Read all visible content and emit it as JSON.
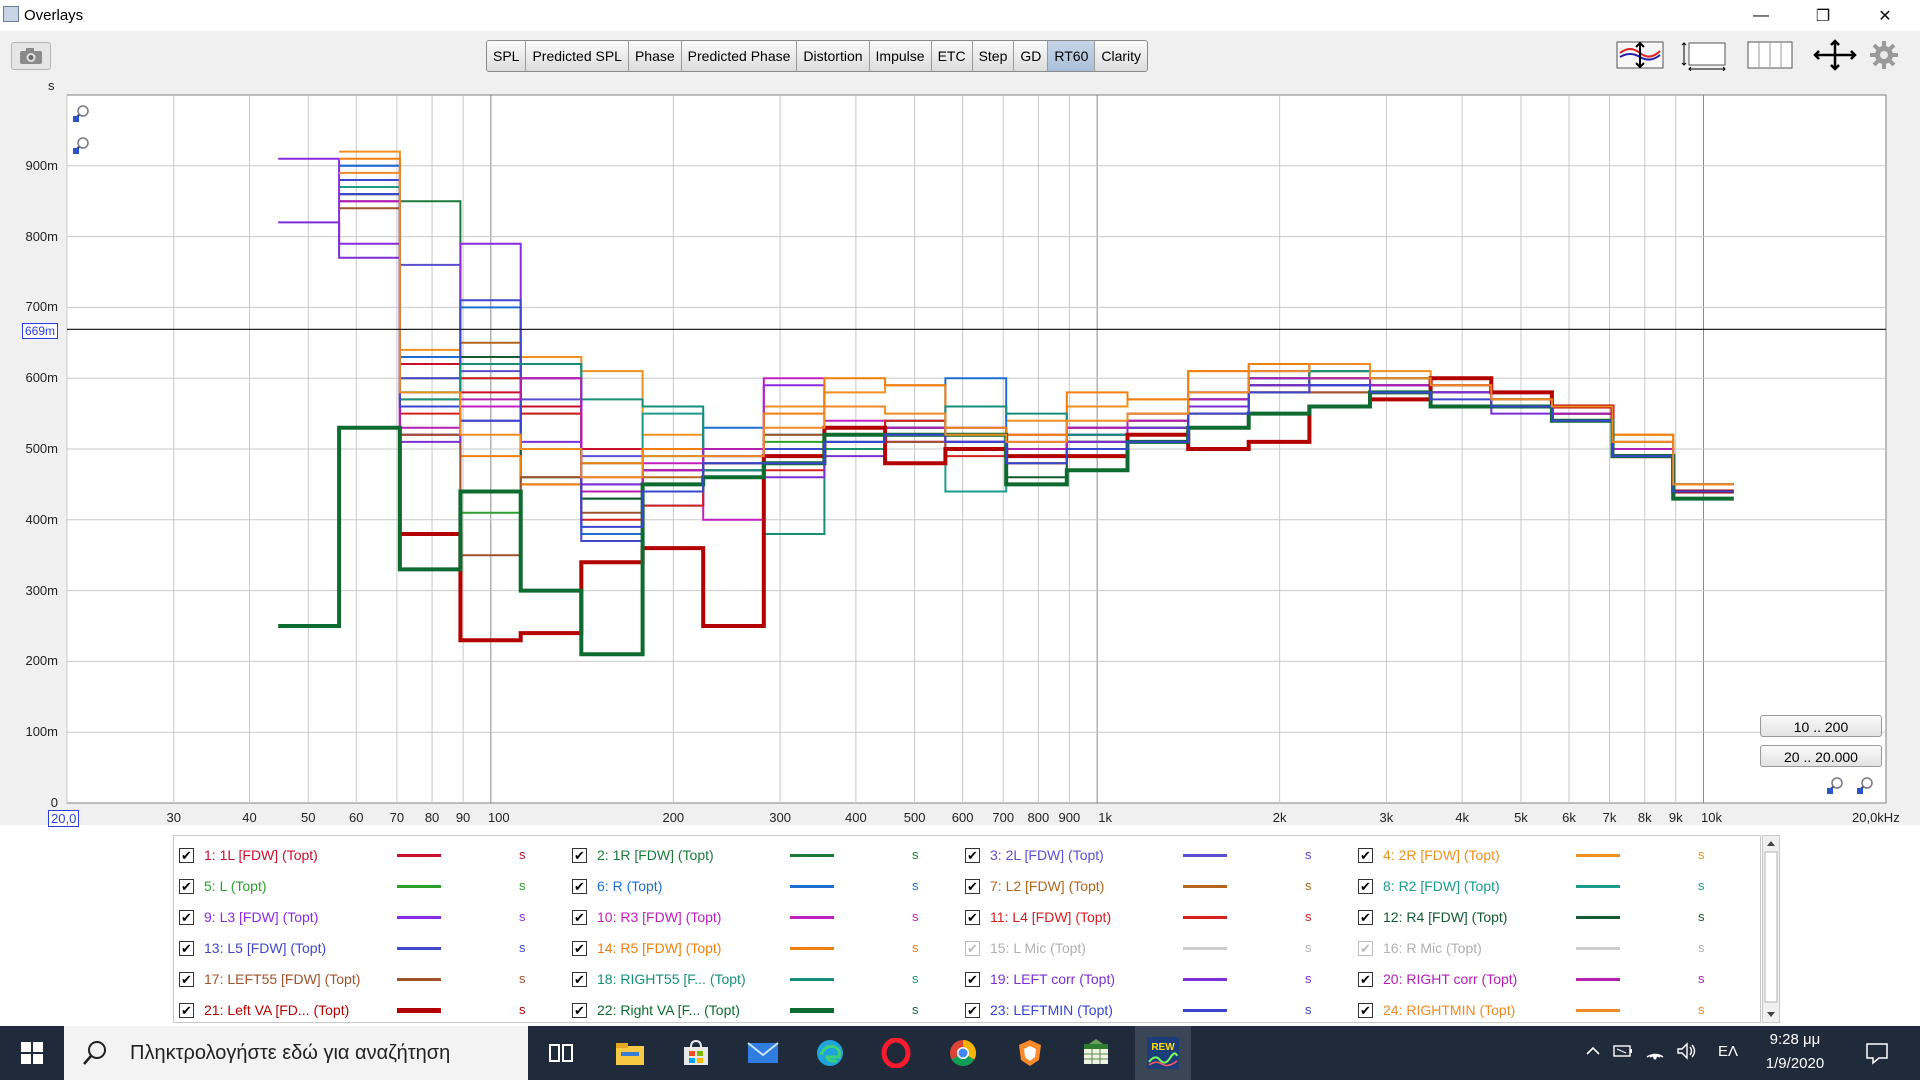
{
  "window": {
    "title": "Overlays",
    "controls": [
      "—",
      "❐",
      "✕"
    ]
  },
  "toolbar": {
    "tabs": [
      {
        "label": "SPL",
        "active": false
      },
      {
        "label": "Predicted SPL",
        "active": false
      },
      {
        "label": "Phase",
        "active": false
      },
      {
        "label": "Predicted Phase",
        "active": false
      },
      {
        "label": "Distortion",
        "active": false
      },
      {
        "label": "Impulse",
        "active": false
      },
      {
        "label": "ETC",
        "active": false
      },
      {
        "label": "Step",
        "active": false
      },
      {
        "label": "GD",
        "active": false
      },
      {
        "label": "RT60",
        "active": true
      },
      {
        "label": "Clarity",
        "active": false
      }
    ],
    "right_icons": [
      "y-scale-icon",
      "limits-icon",
      "panels-icon",
      "pan-icon",
      "gear-icon"
    ]
  },
  "graph": {
    "y_unit": "s",
    "y_ticks": [
      "0",
      "100m",
      "200m",
      "300m",
      "400m",
      "500m",
      "600m",
      "700m",
      "800m",
      "900m"
    ],
    "x_ticks": [
      "30",
      "40",
      "50",
      "60",
      "70",
      "80",
      "90",
      "100",
      "200",
      "300",
      "400",
      "500",
      "600",
      "700",
      "800",
      "900",
      "1k",
      "2k",
      "3k",
      "4k",
      "5k",
      "6k",
      "7k",
      "8k",
      "9k",
      "10k"
    ],
    "x_start": "20,0",
    "x_end": "20,0kHz",
    "cursor_y": "669m",
    "range_buttons": [
      "10 .. 200",
      "20 .. 20.000"
    ]
  },
  "chart_data": {
    "type": "line",
    "x_scale": "log",
    "xlim": [
      20,
      20000
    ],
    "ylim": [
      0,
      1.0
    ],
    "xlabel": "",
    "ylabel": "s",
    "x_unit": "Hz",
    "cursor_y": 0.669,
    "band_edges": [
      44.6,
      56.2,
      70.8,
      89.1,
      112,
      141,
      178,
      224,
      282,
      355,
      447,
      562,
      708,
      891,
      1122,
      1413,
      1778,
      2239,
      2818,
      3548,
      4467,
      5623,
      7079,
      8913,
      11220
    ],
    "series": [
      {
        "name": "1: 1L [FDW] (Topt)",
        "color": "#c8102e",
        "width": 2,
        "values": [
          null,
          null,
          0.62,
          0.58,
          0.56,
          0.5,
          0.47,
          0.48,
          0.49,
          0.5,
          0.51,
          0.52,
          0.52,
          0.53,
          0.55,
          0.57,
          0.58,
          0.6,
          0.59,
          0.58,
          0.57,
          0.55,
          0.5,
          0.44
        ]
      },
      {
        "name": "2: 1R [FDW] (Topt)",
        "color": "#1b7a3a",
        "width": 2,
        "values": [
          null,
          0.88,
          0.85,
          0.6,
          0.55,
          0.48,
          0.44,
          0.46,
          0.48,
          0.51,
          0.52,
          0.51,
          0.49,
          0.5,
          0.52,
          0.56,
          0.59,
          0.61,
          0.6,
          0.59,
          0.57,
          0.56,
          0.49,
          0.44
        ]
      },
      {
        "name": "3: 2L [FDW] (Topt)",
        "color": "#5a4fcf",
        "width": 2,
        "values": [
          null,
          0.9,
          0.76,
          0.61,
          0.57,
          0.49,
          0.45,
          0.48,
          0.5,
          0.52,
          0.53,
          0.52,
          0.5,
          0.52,
          0.54,
          0.58,
          0.6,
          0.6,
          0.59,
          0.58,
          0.56,
          0.55,
          0.49,
          0.45
        ]
      },
      {
        "name": "4: 2R [FDW] (Topt)",
        "color": "#f0901f",
        "width": 2,
        "values": [
          null,
          0.92,
          0.64,
          0.63,
          0.63,
          0.61,
          0.52,
          0.5,
          0.56,
          0.58,
          0.59,
          0.56,
          0.54,
          0.56,
          0.57,
          0.61,
          0.62,
          0.6,
          0.61,
          0.6,
          0.58,
          0.56,
          0.52,
          0.45
        ]
      },
      {
        "name": "5: L (Topt)",
        "color": "#2ca02c",
        "width": 2,
        "values": [
          null,
          0.87,
          0.58,
          0.41,
          0.5,
          0.43,
          0.49,
          0.5,
          0.51,
          0.52,
          0.53,
          0.52,
          0.5,
          0.51,
          0.53,
          0.56,
          0.59,
          0.61,
          0.6,
          0.6,
          0.57,
          0.55,
          0.49,
          0.44
        ]
      },
      {
        "name": "6: R (Topt)",
        "color": "#1f6fd1",
        "width": 2,
        "values": [
          null,
          0.9,
          0.63,
          0.7,
          0.5,
          0.38,
          0.42,
          0.53,
          0.49,
          0.51,
          0.52,
          0.6,
          0.5,
          0.51,
          0.52,
          0.57,
          0.6,
          0.6,
          0.58,
          0.58,
          0.56,
          0.55,
          0.5,
          0.45
        ]
      },
      {
        "name": "7: L2 [FDW] (Topt)",
        "color": "#b5651d",
        "width": 2,
        "values": [
          null,
          0.86,
          0.6,
          0.65,
          0.45,
          0.44,
          0.46,
          0.5,
          0.5,
          0.53,
          0.54,
          0.51,
          0.5,
          0.51,
          0.54,
          0.56,
          0.59,
          0.61,
          0.6,
          0.59,
          0.57,
          0.56,
          0.51,
          0.45
        ]
      },
      {
        "name": "8: R2 [FDW] (Topt)",
        "color": "#1a9b8c",
        "width": 2,
        "values": [
          null,
          0.87,
          0.58,
          0.62,
          0.62,
          0.43,
          0.55,
          0.49,
          0.52,
          0.53,
          0.54,
          0.44,
          0.45,
          0.51,
          0.52,
          0.57,
          0.59,
          0.6,
          0.59,
          0.59,
          0.56,
          0.55,
          0.5,
          0.45
        ]
      },
      {
        "name": "9: L3 [FDW] (Topt)",
        "color": "#8a2be2",
        "width": 2,
        "values": [
          0.91,
          0.79,
          0.52,
          0.79,
          0.6,
          0.45,
          0.5,
          0.47,
          0.59,
          0.5,
          0.52,
          0.53,
          0.51,
          0.53,
          0.55,
          0.58,
          0.61,
          0.59,
          0.58,
          0.58,
          0.56,
          0.54,
          0.5,
          0.44
        ]
      },
      {
        "name": "10: R3 [FDW] (Topt)",
        "color": "#c020c0",
        "width": 2,
        "values": [
          null,
          0.85,
          0.52,
          0.56,
          0.6,
          0.46,
          0.48,
          0.4,
          0.6,
          0.54,
          0.51,
          0.5,
          0.5,
          0.52,
          0.53,
          0.57,
          0.59,
          0.59,
          0.59,
          0.58,
          0.56,
          0.55,
          0.5,
          0.44
        ]
      },
      {
        "name": "11: L4 [FDW] (Topt)",
        "color": "#d62020",
        "width": 2,
        "values": [
          null,
          0.86,
          0.55,
          0.6,
          0.55,
          0.4,
          0.42,
          0.49,
          0.47,
          0.52,
          0.54,
          0.49,
          0.48,
          0.5,
          0.51,
          0.55,
          0.58,
          0.58,
          0.57,
          0.59,
          0.57,
          0.56,
          0.5,
          0.44
        ]
      },
      {
        "name": "12: R4 [FDW] (Topt)",
        "color": "#145a32",
        "width": 2,
        "values": [
          null,
          0.88,
          0.56,
          0.63,
          0.46,
          0.43,
          0.44,
          0.47,
          0.5,
          0.52,
          0.53,
          0.52,
          0.46,
          0.51,
          0.53,
          0.56,
          0.59,
          0.62,
          0.6,
          0.6,
          0.58,
          0.56,
          0.49,
          0.44
        ]
      },
      {
        "name": "13: L5 [FDW] (Topt)",
        "color": "#3f48cc",
        "width": 2,
        "values": [
          null,
          0.88,
          0.6,
          0.71,
          0.5,
          0.37,
          0.45,
          0.46,
          0.5,
          0.52,
          0.53,
          0.51,
          0.49,
          0.52,
          0.53,
          0.57,
          0.6,
          0.59,
          0.59,
          0.58,
          0.56,
          0.55,
          0.5,
          0.45
        ]
      },
      {
        "name": "14: R5 [FDW] (Topt)",
        "color": "#f07f0f",
        "width": 2,
        "values": [
          null,
          0.91,
          0.57,
          0.49,
          0.45,
          0.48,
          0.5,
          0.5,
          0.55,
          0.6,
          0.59,
          0.53,
          0.52,
          0.58,
          0.57,
          0.61,
          0.62,
          0.6,
          0.6,
          0.59,
          0.57,
          0.56,
          0.52,
          0.45
        ]
      },
      {
        "name": "15: L Mic (Topt)",
        "color": "#bbbbbb",
        "width": 2,
        "disabled": true,
        "values": []
      },
      {
        "name": "16: R Mic (Topt)",
        "color": "#bbbbbb",
        "width": 2,
        "disabled": true,
        "values": []
      },
      {
        "name": "17: LEFT55 [FDW] (Topt)",
        "color": "#a0522d",
        "width": 2,
        "values": [
          null,
          0.84,
          0.52,
          0.35,
          0.46,
          0.41,
          0.47,
          0.48,
          0.52,
          0.52,
          0.51,
          0.5,
          0.48,
          0.51,
          0.52,
          0.55,
          0.58,
          0.58,
          0.57,
          0.58,
          0.56,
          0.55,
          0.51,
          0.44
        ]
      },
      {
        "name": "18: RIGHT55 [F... (Topt)",
        "color": "#168f7a",
        "width": 2,
        "values": [
          null,
          0.86,
          0.57,
          0.62,
          0.62,
          0.57,
          0.56,
          0.47,
          0.38,
          0.5,
          0.52,
          0.56,
          0.55,
          0.52,
          0.53,
          0.57,
          0.6,
          0.61,
          0.6,
          0.6,
          0.57,
          0.56,
          0.5,
          0.44
        ]
      },
      {
        "name": "19: LEFT corr (Topt)",
        "color": "#7b2fd6",
        "width": 2,
        "values": [
          0.82,
          0.77,
          0.51,
          0.54,
          0.51,
          0.45,
          0.47,
          0.49,
          0.46,
          0.49,
          0.52,
          0.51,
          0.5,
          0.51,
          0.53,
          0.56,
          0.59,
          0.59,
          0.58,
          0.58,
          0.55,
          0.54,
          0.49,
          0.44
        ]
      },
      {
        "name": "20: RIGHT corr (Topt)",
        "color": "#b31fb3",
        "width": 2,
        "values": [
          null,
          0.85,
          0.53,
          0.57,
          0.6,
          0.44,
          0.47,
          0.5,
          0.49,
          0.52,
          0.53,
          0.51,
          0.5,
          0.53,
          0.54,
          0.57,
          0.6,
          0.6,
          0.59,
          0.59,
          0.56,
          0.55,
          0.5,
          0.44
        ]
      },
      {
        "name": "21: Left VA [FD... (Topt)",
        "color": "#b30000",
        "width": 4,
        "values": [
          null,
          null,
          0.38,
          0.23,
          0.24,
          0.34,
          0.36,
          0.25,
          0.49,
          0.53,
          0.48,
          0.5,
          0.49,
          0.49,
          0.52,
          0.5,
          0.51,
          0.56,
          0.57,
          0.6,
          0.58,
          0.56,
          0.49,
          0.44
        ]
      },
      {
        "name": "22: Right VA [F... (Topt)",
        "color": "#0e6b2f",
        "width": 4,
        "values": [
          0.25,
          0.53,
          0.33,
          0.44,
          0.3,
          0.21,
          0.45,
          0.46,
          0.48,
          0.52,
          0.52,
          0.52,
          0.45,
          0.47,
          0.51,
          0.53,
          0.55,
          0.56,
          0.58,
          0.56,
          0.56,
          0.54,
          0.49,
          0.43
        ]
      },
      {
        "name": "23: LEFTMIN (Topt)",
        "color": "#3845cf",
        "width": 2,
        "values": [
          null,
          0.86,
          0.56,
          0.54,
          0.5,
          0.39,
          0.44,
          0.48,
          0.48,
          0.51,
          0.52,
          0.51,
          0.48,
          0.5,
          0.51,
          0.55,
          0.58,
          0.59,
          0.58,
          0.57,
          0.56,
          0.54,
          0.49,
          0.44
        ]
      },
      {
        "name": "24: RIGHTMIN (Topt)",
        "color": "#f08a24",
        "width": 2,
        "values": [
          null,
          0.89,
          0.58,
          0.52,
          0.5,
          0.46,
          0.49,
          0.49,
          0.53,
          0.56,
          0.55,
          0.52,
          0.51,
          0.54,
          0.55,
          0.58,
          0.61,
          0.62,
          0.6,
          0.59,
          0.57,
          0.56,
          0.51,
          0.45
        ]
      }
    ]
  },
  "legend": {
    "unit": "s",
    "items": [
      {
        "label": "1: 1L [FDW] (Topt)",
        "color": "#c8102e",
        "checked": true,
        "thick": false
      },
      {
        "label": "2: 1R [FDW] (Topt)",
        "color": "#1b7a3a",
        "checked": true,
        "thick": false
      },
      {
        "label": "3: 2L [FDW] (Topt)",
        "color": "#5a4fcf",
        "checked": true,
        "thick": false
      },
      {
        "label": "4: 2R [FDW] (Topt)",
        "color": "#f0901f",
        "checked": true,
        "thick": false
      },
      {
        "label": "5: L (Topt)",
        "color": "#2ca02c",
        "checked": true,
        "thick": false
      },
      {
        "label": "6: R (Topt)",
        "color": "#1f6fd1",
        "checked": true,
        "thick": false
      },
      {
        "label": "7: L2 [FDW] (Topt)",
        "color": "#b5651d",
        "checked": true,
        "thick": false
      },
      {
        "label": "8: R2 [FDW] (Topt)",
        "color": "#1a9b8c",
        "checked": true,
        "thick": false
      },
      {
        "label": "9: L3 [FDW] (Topt)",
        "color": "#8a2be2",
        "checked": true,
        "thick": false
      },
      {
        "label": "10: R3 [FDW] (Topt)",
        "color": "#c020c0",
        "checked": true,
        "thick": false
      },
      {
        "label": "11: L4 [FDW] (Topt)",
        "color": "#d62020",
        "checked": true,
        "thick": false
      },
      {
        "label": "12: R4 [FDW] (Topt)",
        "color": "#145a32",
        "checked": true,
        "thick": false
      },
      {
        "label": "13: L5 [FDW] (Topt)",
        "color": "#3f48cc",
        "checked": true,
        "thick": false
      },
      {
        "label": "14: R5 [FDW] (Topt)",
        "color": "#f07f0f",
        "checked": true,
        "thick": false
      },
      {
        "label": "15: L Mic (Topt)",
        "color": "#bbbbbb",
        "checked": false,
        "thick": false
      },
      {
        "label": "16: R Mic (Topt)",
        "color": "#bbbbbb",
        "checked": false,
        "thick": false
      },
      {
        "label": "17: LEFT55 [FDW] (Topt)",
        "color": "#a0522d",
        "checked": true,
        "thick": false
      },
      {
        "label": "18: RIGHT55 [F... (Topt)",
        "color": "#168f7a",
        "checked": true,
        "thick": false
      },
      {
        "label": "19: LEFT corr (Topt)",
        "color": "#7b2fd6",
        "checked": true,
        "thick": false
      },
      {
        "label": "20: RIGHT corr (Topt)",
        "color": "#b31fb3",
        "checked": true,
        "thick": false
      },
      {
        "label": "21: Left VA [FD... (Topt)",
        "color": "#b30000",
        "checked": true,
        "thick": true
      },
      {
        "label": "22: Right VA [F... (Topt)",
        "color": "#0e6b2f",
        "checked": true,
        "thick": true
      },
      {
        "label": "23: LEFTMIN (Topt)",
        "color": "#3845cf",
        "checked": true,
        "thick": false
      },
      {
        "label": "24: RIGHTMIN (Topt)",
        "color": "#f08a24",
        "checked": true,
        "thick": false
      }
    ]
  },
  "taskbar": {
    "search_placeholder": "Πληκτρολογήστε εδώ για αναζήτηση",
    "apps": [
      "task-view-icon",
      "file-explorer-icon",
      "store-icon",
      "mail-icon",
      "edge-icon",
      "opera-icon",
      "chrome-icon",
      "brave-icon",
      "spreadsheet-icon",
      "rew-icon"
    ],
    "lang": "ΕΛ",
    "time": "9:28 μμ",
    "date": "1/9/2020"
  }
}
